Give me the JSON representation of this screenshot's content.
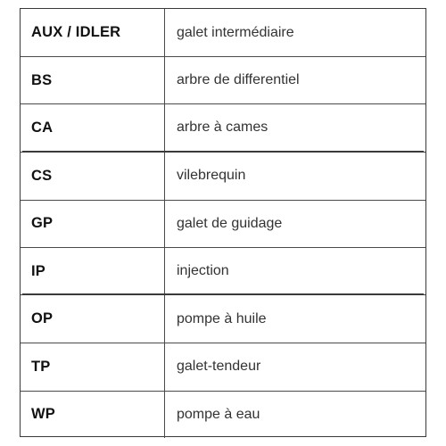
{
  "table": {
    "name": "abbreviation-glossary",
    "columns": [
      "code",
      "description"
    ],
    "groups": [
      {
        "rows": [
          {
            "code": "AUX / IDLER",
            "description": "galet intermédiaire"
          },
          {
            "code": "BS",
            "description": "arbre de differentiel"
          },
          {
            "code": "CA",
            "description": "arbre à cames"
          }
        ]
      },
      {
        "rows": [
          {
            "code": "CS",
            "description": "vilebrequin"
          },
          {
            "code": "GP",
            "description": "galet de guidage"
          },
          {
            "code": "IP",
            "description": "injection"
          }
        ]
      },
      {
        "rows": [
          {
            "code": "OP",
            "description": "pompe à huile"
          },
          {
            "code": "TP",
            "description": "galet-tendeur"
          },
          {
            "code": "WP",
            "description": "pompe à eau"
          }
        ]
      }
    ]
  },
  "colors": {
    "background": "#ffffff",
    "border": "#3a3a3a",
    "inner_border": "#4a4a4a",
    "code_text": "#111111",
    "description_text": "#333333"
  }
}
